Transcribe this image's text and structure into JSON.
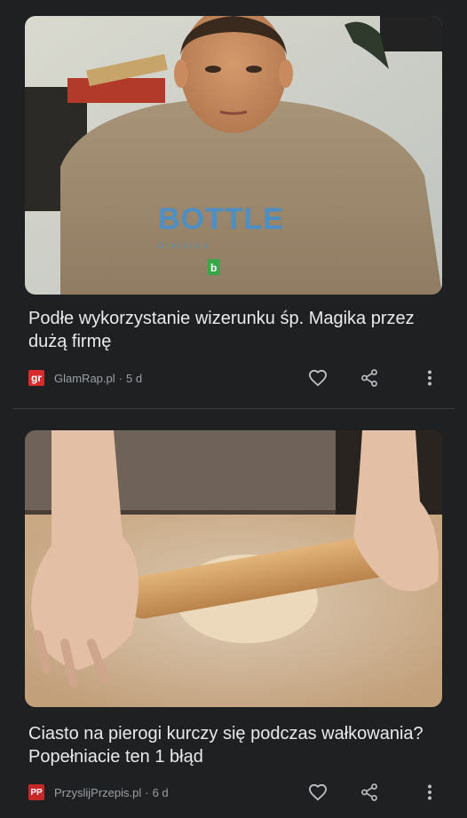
{
  "articles": [
    {
      "title": "Podłe wykorzystanie wizerunku śp. Magika przez dużą firmę",
      "source_logo_text": "gr",
      "source": "GlamRap.pl",
      "separator": "·",
      "age": "5 d",
      "image_text": {
        "brand": "BOTTLE",
        "sub": "D I V I S I O N",
        "badge": "b"
      }
    },
    {
      "title": "Ciasto na pierogi kurczy się podczas wałkowania? Popełniacie ten 1 błąd",
      "source_logo_text": "PP",
      "source": "PrzyslijPrzepis.pl",
      "separator": "·",
      "age": "6 d"
    }
  ],
  "icons": {
    "like": "heart-outline",
    "share": "share",
    "more": "vertical-dots"
  },
  "colors": {
    "background": "#1f2022",
    "title_text": "#e8eaed",
    "meta_text": "#9aa0a6",
    "glamrap_logo": "#d92b2b",
    "przepis_logo": "#c62828"
  }
}
